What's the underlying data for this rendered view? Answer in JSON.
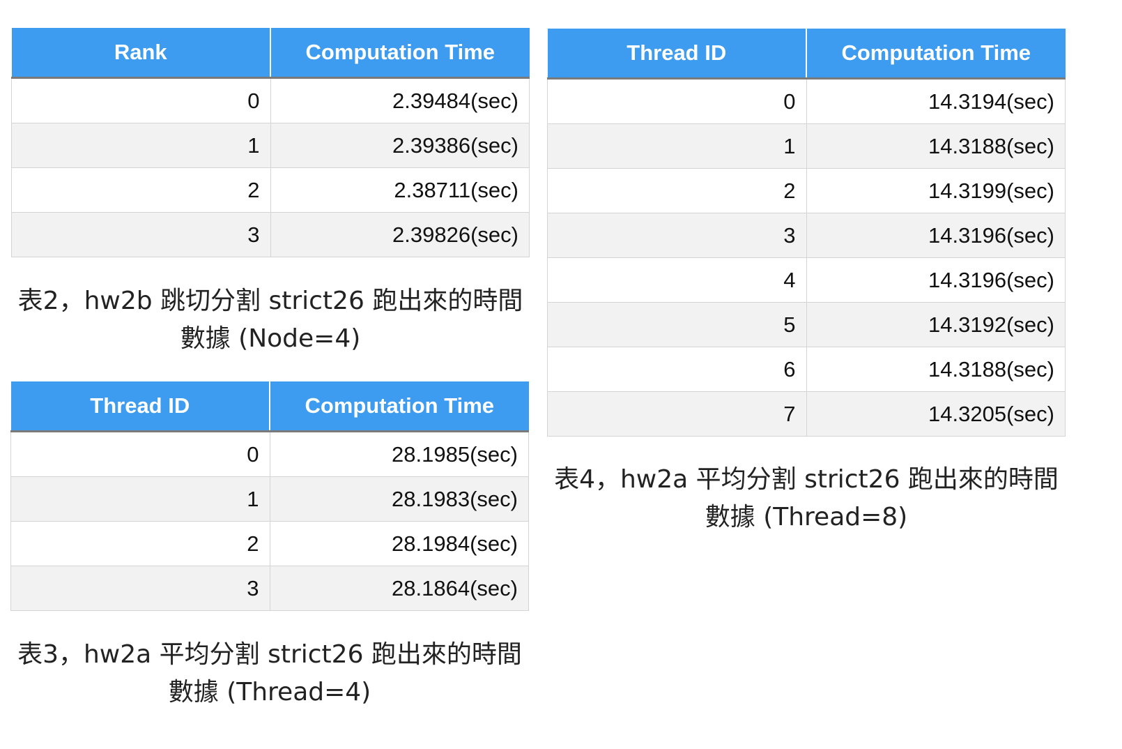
{
  "table2": {
    "headers": [
      "Rank",
      "Computation Time"
    ],
    "rows": [
      [
        "0",
        "2.39484(sec)"
      ],
      [
        "1",
        "2.39386(sec)"
      ],
      [
        "2",
        "2.38711(sec)"
      ],
      [
        "3",
        "2.39826(sec)"
      ]
    ],
    "caption_line1": "表2，hw2b 跳切分割 strict26 跑出來的時間",
    "caption_line2": "數據 (Node=4)"
  },
  "table3": {
    "headers": [
      "Thread ID",
      "Computation Time"
    ],
    "rows": [
      [
        "0",
        "28.1985(sec)"
      ],
      [
        "1",
        "28.1983(sec)"
      ],
      [
        "2",
        "28.1984(sec)"
      ],
      [
        "3",
        "28.1864(sec)"
      ]
    ],
    "caption_line1": "表3，hw2a 平均分割 strict26 跑出來的時間",
    "caption_line2": "數據 (Thread=4)"
  },
  "table4": {
    "headers": [
      "Thread ID",
      "Computation Time"
    ],
    "rows": [
      [
        "0",
        "14.3194(sec)"
      ],
      [
        "1",
        "14.3188(sec)"
      ],
      [
        "2",
        "14.3199(sec)"
      ],
      [
        "3",
        "14.3196(sec)"
      ],
      [
        "4",
        "14.3196(sec)"
      ],
      [
        "5",
        "14.3192(sec)"
      ],
      [
        "6",
        "14.3188(sec)"
      ],
      [
        "7",
        "14.3205(sec)"
      ]
    ],
    "caption_line1": "表4，hw2a 平均分割 strict26 跑出來的時間",
    "caption_line2": "數據 (Thread=8)"
  },
  "colors": {
    "header_bg": "#3d9cf0",
    "header_text": "#ffffff",
    "row_alt_bg": "#f2f2f2"
  }
}
